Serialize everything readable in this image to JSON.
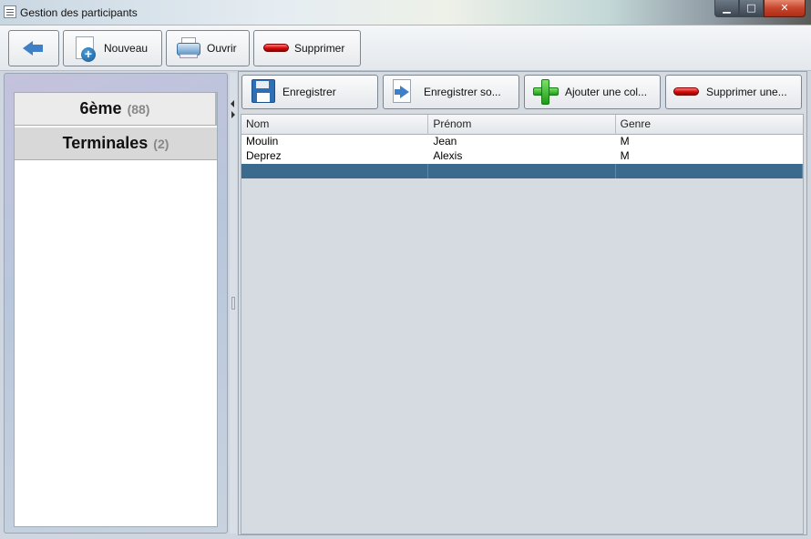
{
  "window": {
    "title": "Gestion des participants",
    "controls": {
      "minimize": "▁",
      "maximize": "□",
      "close": "✕"
    }
  },
  "toolbar": {
    "back_icon": "arrow-left-icon",
    "new_label": "Nouveau",
    "open_label": "Ouvrir",
    "delete_label": "Supprimer"
  },
  "groups": [
    {
      "name": "6ème",
      "count": "(88)"
    },
    {
      "name": "Terminales",
      "count": "(2)"
    }
  ],
  "sub_toolbar": {
    "save_label": "Enregistrer",
    "save_as_label": "Enregistrer so...",
    "add_column_label": "Ajouter une col...",
    "delete_column_label": "Supprimer une..."
  },
  "table": {
    "columns": [
      "Nom",
      "Prénom",
      "Genre"
    ],
    "rows": [
      [
        "Moulin",
        "Jean",
        "M"
      ],
      [
        "Deprez",
        "Alexis",
        "M"
      ],
      [
        "",
        "",
        ""
      ]
    ],
    "selected_row": 2
  },
  "colors": {
    "selection": "#3a6a8e",
    "delete_red": "#d40b0b",
    "add_green": "#1e9b17",
    "icon_blue": "#3f7fc6"
  }
}
